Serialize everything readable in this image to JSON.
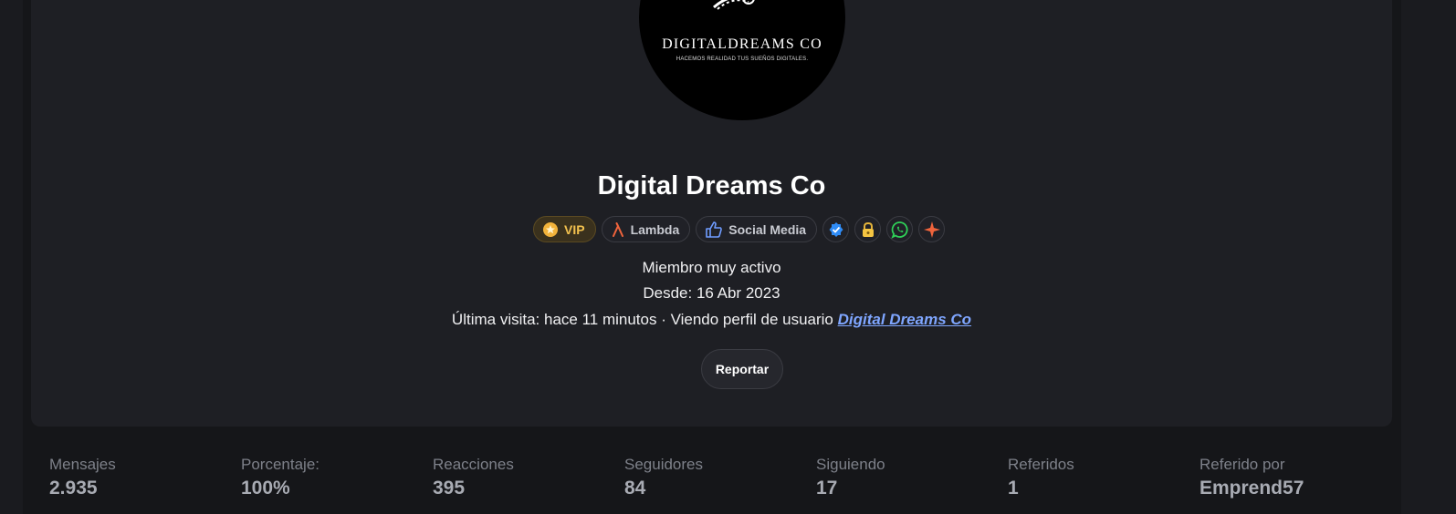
{
  "profile": {
    "avatar_brand": "DIGITALDREAMS CO",
    "avatar_tagline": "HACEMOS REALIDAD TUS SUEÑOS DIGITALES.",
    "name": "Digital Dreams Co",
    "badges": [
      {
        "label": "VIP",
        "icon": "star-coin-icon"
      },
      {
        "label": "Lambda",
        "icon": "lambda-icon"
      },
      {
        "label": "Social Media",
        "icon": "thumbs-up-icon"
      }
    ],
    "icon_badges": [
      "verified-check-icon",
      "lock-icon",
      "whatsapp-icon",
      "sparkle-icon"
    ],
    "rank": "Miembro muy activo",
    "since": "Desde: 16 Abr 2023",
    "last_visit_prefix": "Última visita: hace 11 minutos · Viendo perfil de usuario ",
    "last_visit_link": "Digital Dreams Co",
    "report_label": "Reportar"
  },
  "stats": [
    {
      "label": "Mensajes",
      "value": "2.935"
    },
    {
      "label": "Porcentaje:",
      "value": "100%"
    },
    {
      "label": "Reacciones",
      "value": "395"
    },
    {
      "label": "Seguidores",
      "value": "84"
    },
    {
      "label": "Siguiendo",
      "value": "17"
    },
    {
      "label": "Referidos",
      "value": "1"
    },
    {
      "label": "Referido por",
      "value": "Emprend57"
    }
  ],
  "colors": {
    "background": "#1a1b1f",
    "card": "#1e1f24",
    "vip": "#f2c14e",
    "link": "#7fa6ff",
    "lambda": "#f0643c",
    "verified": "#2f8cf6",
    "whatsapp": "#2fd158"
  }
}
